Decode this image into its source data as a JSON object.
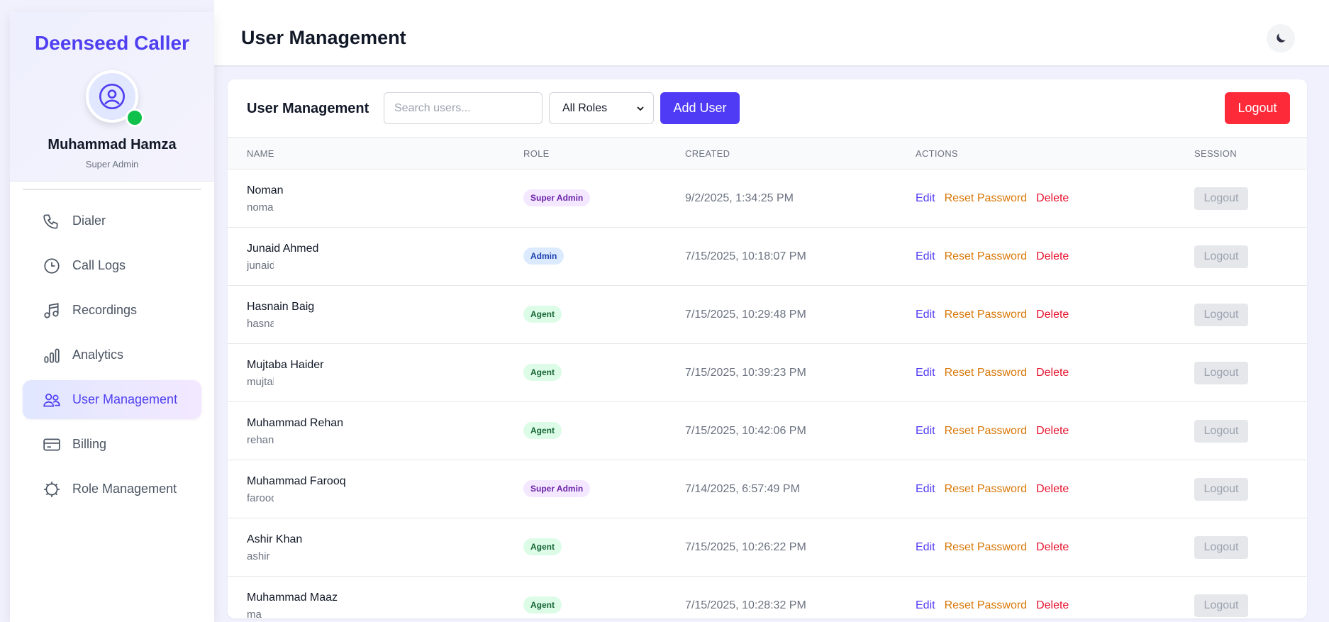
{
  "sidebar": {
    "brand": "Deenseed Caller",
    "user_name": "Muhammad Hamza",
    "user_role": "Super Admin",
    "items": [
      {
        "label": "Dialer",
        "icon": "phone-icon"
      },
      {
        "label": "Call Logs",
        "icon": "clock-icon"
      },
      {
        "label": "Recordings",
        "icon": "music-icon"
      },
      {
        "label": "Analytics",
        "icon": "bar-chart-icon"
      },
      {
        "label": "User Management",
        "icon": "users-icon",
        "active": true
      },
      {
        "label": "Billing",
        "icon": "credit-card-icon"
      },
      {
        "label": "Role Management",
        "icon": "gear-icon"
      }
    ]
  },
  "header": {
    "title": "User Management",
    "theme_icon": "moon-icon"
  },
  "card": {
    "title": "User Management",
    "search_placeholder": "Search users...",
    "role_filter": "All Roles",
    "add_user": "Add User",
    "logout": "Logout"
  },
  "table": {
    "headers": [
      "NAME",
      "ROLE",
      "CREATED",
      "ACTIONS",
      "SESSION"
    ],
    "actions": {
      "edit": "Edit",
      "reset": "Reset Password",
      "delete": "Delete",
      "session": "Logout"
    },
    "rows": [
      {
        "name": "Noman",
        "username": "noma",
        "role": "Super Admin",
        "created": "9/2/2025, 1:34:25 PM"
      },
      {
        "name": "Junaid Ahmed",
        "username": "junaid",
        "role": "Admin",
        "created": "7/15/2025, 10:18:07 PM"
      },
      {
        "name": "Hasnain Baig",
        "username": "hasnain",
        "role": "Agent",
        "created": "7/15/2025, 10:29:48 PM"
      },
      {
        "name": "Mujtaba Haider",
        "username": "mujtaba",
        "role": "Agent",
        "created": "7/15/2025, 10:39:23 PM"
      },
      {
        "name": "Muhammad Rehan",
        "username": "rehan",
        "role": "Agent",
        "created": "7/15/2025, 10:42:06 PM"
      },
      {
        "name": "Muhammad Farooq",
        "username": "farooqahmed",
        "role": "Super Admin",
        "created": "7/14/2025, 6:57:49 PM"
      },
      {
        "name": "Ashir Khan",
        "username": "ashir",
        "role": "Agent",
        "created": "7/15/2025, 10:26:22 PM"
      },
      {
        "name": "Muhammad Maaz",
        "username": "ma",
        "role": "Agent",
        "created": "7/15/2025, 10:28:32 PM"
      }
    ]
  },
  "colors": {
    "brand": "#4f3ff0",
    "logout": "#fd2a3a",
    "online": "#0fc14b"
  }
}
